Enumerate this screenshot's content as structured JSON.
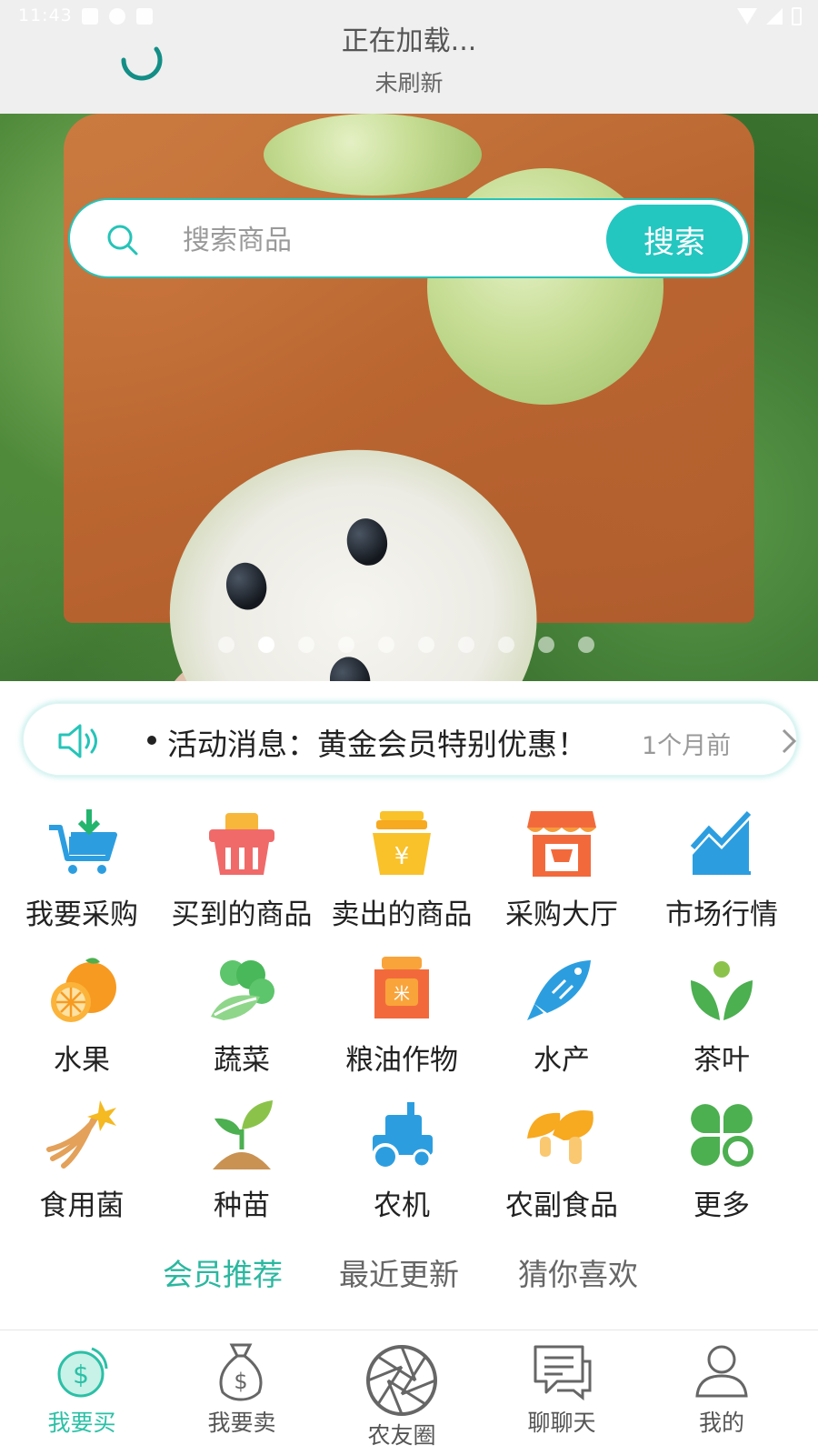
{
  "status_bar": {
    "time": "11:43"
  },
  "refresh": {
    "title": "正在加载...",
    "subtitle": "未刷新"
  },
  "search": {
    "placeholder": "搜索商品",
    "button_label": "搜索"
  },
  "banner": {
    "slide_count": 10,
    "active_index": 1
  },
  "notice": {
    "text": "活动消息：黄金会员特别优惠！",
    "time": "1个月前"
  },
  "categories": [
    {
      "label": "我要采购",
      "icon": "cart-download-icon"
    },
    {
      "label": "买到的商品",
      "icon": "basket-icon"
    },
    {
      "label": "卖出的商品",
      "icon": "money-pot-icon"
    },
    {
      "label": "采购大厅",
      "icon": "store-icon"
    },
    {
      "label": "市场行情",
      "icon": "trend-chart-icon"
    },
    {
      "label": "水果",
      "icon": "orange-icon"
    },
    {
      "label": "蔬菜",
      "icon": "cabbage-icon"
    },
    {
      "label": "粮油作物",
      "icon": "rice-bag-icon"
    },
    {
      "label": "水产",
      "icon": "fish-icon"
    },
    {
      "label": "茶叶",
      "icon": "tea-leaf-icon"
    },
    {
      "label": "食用菌",
      "icon": "ginseng-icon"
    },
    {
      "label": "种苗",
      "icon": "seedling-icon"
    },
    {
      "label": "农机",
      "icon": "tractor-icon"
    },
    {
      "label": "农副食品",
      "icon": "mushroom-icon"
    },
    {
      "label": "更多",
      "icon": "clover-icon"
    }
  ],
  "tabs": [
    {
      "label": "会员推荐",
      "active": true
    },
    {
      "label": "最近更新",
      "active": false
    },
    {
      "label": "猜你喜欢",
      "active": false
    }
  ],
  "bottom_nav": [
    {
      "label": "我要买",
      "icon": "dollar-coin-icon",
      "active": true
    },
    {
      "label": "我要卖",
      "icon": "money-bag-icon",
      "active": false
    },
    {
      "label": "农友圈",
      "icon": "aperture-icon",
      "active": false
    },
    {
      "label": "聊聊天",
      "icon": "chat-icon",
      "active": false
    },
    {
      "label": "我的",
      "icon": "user-icon",
      "active": false
    }
  ],
  "colors": {
    "accent": "#24c6c0",
    "active_tab": "#2bb79f",
    "nav_active": "#2bc0a6"
  }
}
